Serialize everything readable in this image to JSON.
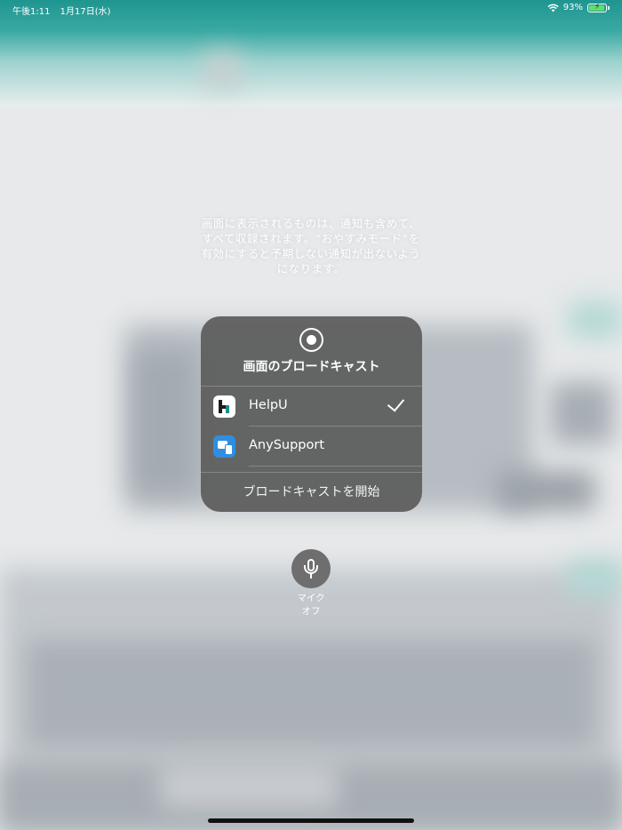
{
  "status_bar": {
    "time": "午後1:11",
    "date": "1月17日(水)",
    "battery_percent": "93%",
    "battery_level": 0.93,
    "wifi_icon": "wifi-icon",
    "charging_icon": "bolt-icon"
  },
  "notice": {
    "text": "画面に表示されるものは、通知も含めて、すべて収録されます。“おやすみモード”を有効にすると予期しない通知が出ないようになります。"
  },
  "broadcast_panel": {
    "title": "画面のブロードキャスト",
    "apps": [
      {
        "name": "HelpU",
        "icon": "helpu-app-icon",
        "selected": true
      },
      {
        "name": "AnySupport",
        "icon": "anysupport-app-icon",
        "selected": false
      }
    ],
    "start_label": "ブロードキャストを開始"
  },
  "microphone": {
    "label_line1": "マイク",
    "label_line2": "オフ",
    "icon": "microphone-icon"
  },
  "colors": {
    "teal_header": "#1f9590",
    "panel_bg": "#606060",
    "battery_green": "#5fe06a"
  }
}
